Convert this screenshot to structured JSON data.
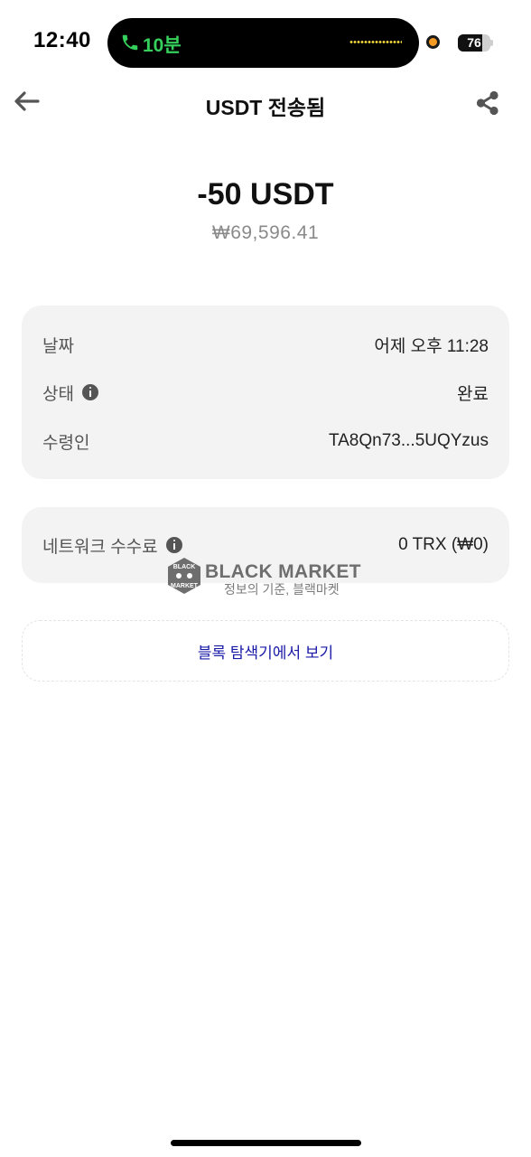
{
  "status_bar": {
    "time": "12:40",
    "call_duration": "10분",
    "call_color": "#35d05b",
    "battery_level": "76",
    "battery_fraction": 0.76
  },
  "header": {
    "title": "USDT 전송됨",
    "back_icon": "arrow-left-icon",
    "share_icon": "share-icon"
  },
  "summary": {
    "amount": "-50 USDT",
    "fiat": "₩69,596.41"
  },
  "details": [
    {
      "label": "날짜",
      "value": "어제 오후 11:28",
      "info": false
    },
    {
      "label": "상태",
      "value": "완료",
      "info": true
    },
    {
      "label": "수령인",
      "value": "TA8Qn73...5UQYzus",
      "info": false
    }
  ],
  "fee": {
    "label": "네트워크 수수료",
    "value": "0 TRX (₩0)",
    "info": true
  },
  "watermark": {
    "title": "BLACK MARKET",
    "subtitle": "정보의 기준, 블랙마켓",
    "badge_text_top": "BLACK",
    "badge_text_bottom": "MARKET"
  },
  "explorer_button": {
    "label": "블록 탐색기에서 보기",
    "color": "#1a1aa8"
  }
}
